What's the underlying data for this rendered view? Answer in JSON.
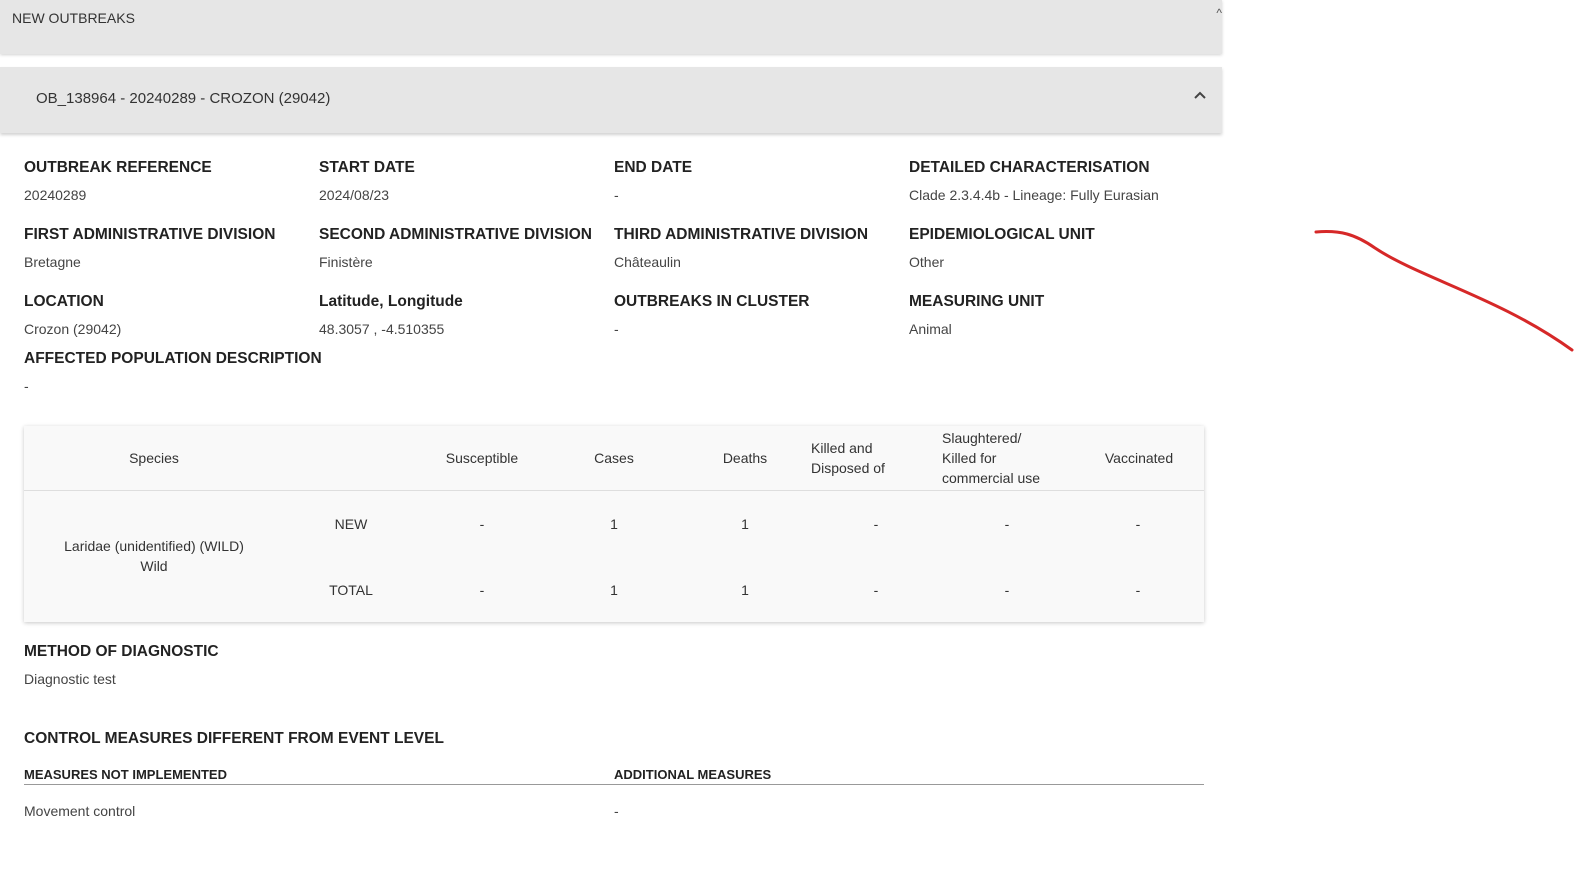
{
  "panel": {
    "title": "NEW OUTBREAKS"
  },
  "outbreak": {
    "header": "OB_138964 - 20240289 - CROZON (29042)",
    "fields": [
      {
        "label": "OUTBREAK REFERENCE",
        "value": "20240289"
      },
      {
        "label": "START DATE",
        "value": "2024/08/23"
      },
      {
        "label": "END DATE",
        "value": "-"
      },
      {
        "label": "DETAILED CHARACTERISATION",
        "value": "Clade 2.3.4.4b - Lineage: Fully Eurasian"
      },
      {
        "label": "FIRST ADMINISTRATIVE DIVISION",
        "value": "Bretagne"
      },
      {
        "label": "SECOND ADMINISTRATIVE DIVISION",
        "value": "Finistère"
      },
      {
        "label": "THIRD ADMINISTRATIVE DIVISION",
        "value": "Châteaulin"
      },
      {
        "label": "EPIDEMIOLOGICAL UNIT",
        "value": "Other"
      },
      {
        "label": "LOCATION",
        "value": "Crozon (29042)"
      },
      {
        "label": "Latitude, Longitude",
        "value": "48.3057 , -4.510355"
      },
      {
        "label": "OUTBREAKS IN CLUSTER",
        "value": "-"
      },
      {
        "label": "MEASURING UNIT",
        "value": "Animal"
      },
      {
        "label": "AFFECTED POPULATION DESCRIPTION",
        "value": "-"
      }
    ]
  },
  "species_table": {
    "headers": {
      "species": "Species",
      "susceptible": "Susceptible",
      "cases": "Cases",
      "deaths": "Deaths",
      "killed_1": "Killed and",
      "killed_2": "Disposed of",
      "slaughtered_1": "Slaughtered/",
      "slaughtered_2": "Killed for",
      "slaughtered_3": "commercial use",
      "vaccinated": "Vaccinated"
    },
    "species_name": "Laridae (unidentified) (WILD)",
    "species_type": "Wild",
    "rows": [
      {
        "label": "NEW",
        "susceptible": "-",
        "cases": "1",
        "deaths": "1",
        "killed": "-",
        "slaughtered": "-",
        "vaccinated": "-"
      },
      {
        "label": "TOTAL",
        "susceptible": "-",
        "cases": "1",
        "deaths": "1",
        "killed": "-",
        "slaughtered": "-",
        "vaccinated": "-"
      }
    ]
  },
  "diagnostic": {
    "label": "METHOD OF DIAGNOSTIC",
    "value": "Diagnostic test"
  },
  "control": {
    "title": "CONTROL MEASURES DIFFERENT FROM EVENT LEVEL",
    "not_implemented_label": "MEASURES NOT IMPLEMENTED",
    "additional_label": "ADDITIONAL MEASURES",
    "not_implemented_value": "Movement control",
    "additional_value": "-"
  },
  "colors": {
    "panel_bg": "#e6e6e6",
    "annotation_stroke": "#d62828"
  }
}
